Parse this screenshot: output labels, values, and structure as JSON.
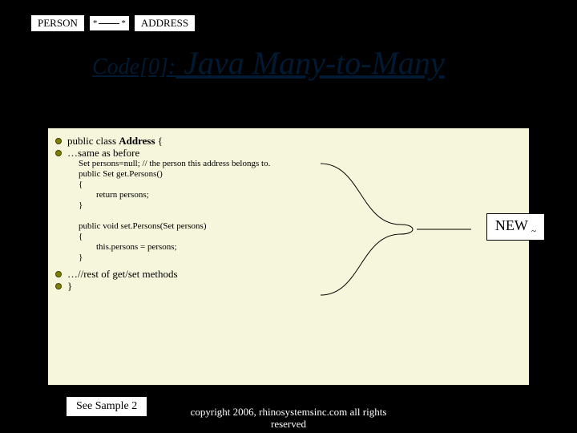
{
  "uml": {
    "left": "PERSON",
    "mult_left": "*",
    "mult_right": "*",
    "right": "ADDRESS"
  },
  "title": {
    "small": "Code[0]:",
    "big": " Java Many-to-Many"
  },
  "code": {
    "l1_pre": "public class ",
    "l1_bold": "Address",
    "l1_post": " {",
    "l2": "…same as before",
    "s1": "Set persons=null; // the person this address belongs to.",
    "s2": "public Set get.Persons()",
    "s3": "{",
    "s4": "        return persons;",
    "s5": "}",
    "s6": "public void set.Persons(Set persons)",
    "s7": "{",
    "s8": "        this.persons = persons;",
    "s9": "}",
    "l3": "…//rest of get/set methods",
    "l4": "}"
  },
  "newbox": {
    "label": "NEW",
    "mark": "~"
  },
  "see": "See Sample 2",
  "copyright": "copyright 2006, rhinosystemsinc.com all rights reserved"
}
